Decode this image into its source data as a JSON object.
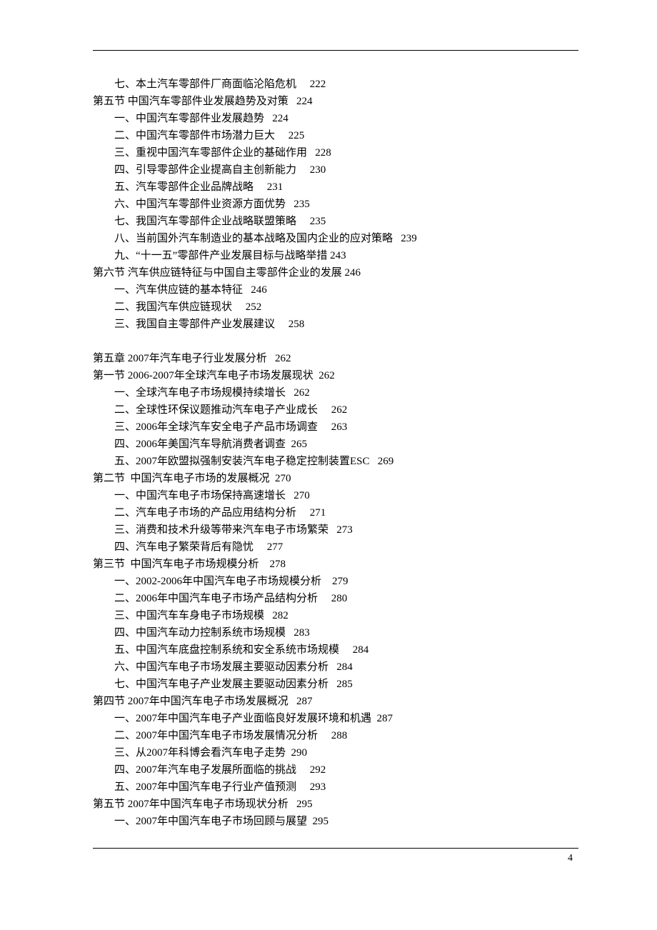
{
  "lines": [
    {
      "indent": 1,
      "text": "七、本土汽车零部件厂商面临沦陷危机     222"
    },
    {
      "indent": 0,
      "text": "第五节 中国汽车零部件业发展趋势及对策   224"
    },
    {
      "indent": 1,
      "text": "一、中国汽车零部件业发展趋势   224"
    },
    {
      "indent": 1,
      "text": "二、中国汽车零部件市场潜力巨大     225"
    },
    {
      "indent": 1,
      "text": "三、重视中国汽车零部件企业的基础作用   228"
    },
    {
      "indent": 1,
      "text": "四、引导零部件企业提高自主创新能力     230"
    },
    {
      "indent": 1,
      "text": "五、汽车零部件企业品牌战略     231"
    },
    {
      "indent": 1,
      "text": "六、中国汽车零部件业资源方面优势   235"
    },
    {
      "indent": 1,
      "text": "七、我国汽车零部件企业战略联盟策略     235"
    },
    {
      "indent": 1,
      "text": "八、当前国外汽车制造业的基本战略及国内企业的应对策略   239"
    },
    {
      "indent": 1,
      "text": "九、“十一五”零部件产业发展目标与战略举措 243"
    },
    {
      "indent": 0,
      "text": "第六节 汽车供应链特征与中国自主零部件企业的发展 246"
    },
    {
      "indent": 1,
      "text": "一、汽车供应链的基本特征   246"
    },
    {
      "indent": 1,
      "text": "二、我国汽车供应链现状     252"
    },
    {
      "indent": 1,
      "text": "三、我国自主零部件产业发展建议     258"
    },
    {
      "blank": true
    },
    {
      "indent": 0,
      "text": "第五章 2007年汽车电子行业发展分析   262"
    },
    {
      "indent": 0,
      "text": "第一节 2006-2007年全球汽车电子市场发展现状  262"
    },
    {
      "indent": 1,
      "text": "一、全球汽车电子市场规模持续增长   262"
    },
    {
      "indent": 1,
      "text": "二、全球性环保议题推动汽车电子产业成长     262"
    },
    {
      "indent": 1,
      "text": "三、2006年全球汽车安全电子产品市场调查     263"
    },
    {
      "indent": 1,
      "text": "四、2006年美国汽车导航消费者调查  265"
    },
    {
      "indent": 1,
      "text": "五、2007年欧盟拟强制安装汽车电子稳定控制装置ESC   269"
    },
    {
      "indent": 0,
      "text": "第二节  中国汽车电子市场的发展概况  270"
    },
    {
      "indent": 1,
      "text": "一、中国汽车电子市场保持高速增长   270"
    },
    {
      "indent": 1,
      "text": "二、汽车电子市场的产品应用结构分析     271"
    },
    {
      "indent": 1,
      "text": "三、消费和技术升级等带来汽车电子市场繁荣   273"
    },
    {
      "indent": 1,
      "text": "四、汽车电子繁荣背后有隐忧     277"
    },
    {
      "indent": 0,
      "text": "第三节  中国汽车电子市场规模分析    278"
    },
    {
      "indent": 1,
      "text": "一、2002-2006年中国汽车电子市场规模分析    279"
    },
    {
      "indent": 1,
      "text": "二、2006年中国汽车电子市场产品结构分析     280"
    },
    {
      "indent": 1,
      "text": "三、中国汽车车身电子市场规模   282"
    },
    {
      "indent": 1,
      "text": "四、中国汽车动力控制系统市场规模   283"
    },
    {
      "indent": 1,
      "text": "五、中国汽车底盘控制系统和安全系统市场规模     284"
    },
    {
      "indent": 1,
      "text": "六、中国汽车电子市场发展主要驱动因素分析   284"
    },
    {
      "indent": 1,
      "text": "七、中国汽车电子产业发展主要驱动因素分析   285"
    },
    {
      "indent": 0,
      "text": "第四节 2007年中国汽车电子市场发展概况   287"
    },
    {
      "indent": 1,
      "text": "一、2007年中国汽车电子产业面临良好发展环境和机遇  287"
    },
    {
      "indent": 1,
      "text": "二、2007年中国汽车电子市场发展情况分析     288"
    },
    {
      "indent": 1,
      "text": "三、从2007年科博会看汽车电子走势  290"
    },
    {
      "indent": 1,
      "text": "四、2007年汽车电子发展所面临的挑战     292"
    },
    {
      "indent": 1,
      "text": "五、2007年中国汽车电子行业产值预测     293"
    },
    {
      "indent": 0,
      "text": "第五节 2007年中国汽车电子市场现状分析   295"
    },
    {
      "indent": 1,
      "text": "一、2007年中国汽车电子市场回顾与展望  295"
    }
  ],
  "page_number": "4"
}
